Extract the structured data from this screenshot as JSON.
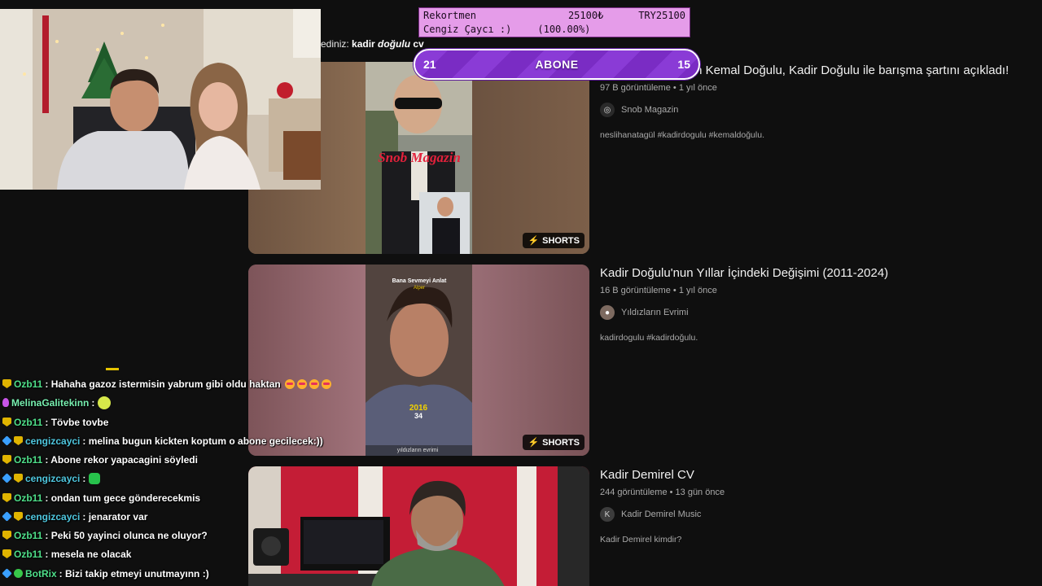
{
  "search_hint": {
    "prefix": "ediniz:",
    "query_plain": "kadir ",
    "query_emph": "doğulu",
    "query_suffix": " cv"
  },
  "results": [
    {
      "title": "…deşim yok' diyen Kemal Doğulu, Kadir Doğulu ile barışma şartını açıkladı!",
      "views": "97 B görüntüleme",
      "age": "1 yıl önce",
      "channel": "Snob Magazin",
      "channel_icon": "snob-avatar",
      "description": "neslihanatagül #kadirdogulu #kemaldoğulu.",
      "badge": "SHORTS",
      "thumb_caption": "Snob Magazin"
    },
    {
      "title": "Kadir Doğulu'nun Yıllar İçindeki Değişimi (2011-2024)",
      "views": "16 B görüntüleme",
      "age": "1 yıl önce",
      "channel": "Yıldızların Evrimi",
      "channel_icon": "person-avatar",
      "description": "kadirdogulu #kadirdoğulu.",
      "badge": "SHORTS",
      "thumb_top_title": "Bana Sevmeyi Anlat",
      "thumb_top_sub": "Alper",
      "thumb_year": "2016",
      "thumb_age": "34",
      "thumb_watermark": "yıldızların evrimi"
    },
    {
      "title": "Kadir Demirel CV",
      "views": "244 görüntüleme",
      "age": "13 gün önce",
      "channel": "Kadir Demirel Music",
      "channel_letter": "K",
      "description": "Kadir Demirel kimdir?"
    }
  ],
  "record_widget": {
    "label1": "Rekortmen",
    "value1": "25100₺",
    "value2": "TRY25100",
    "name": "Cengiz Çaycı :)",
    "percent": "(100.00%)"
  },
  "sub_goal": {
    "left": "21",
    "label": "ABONE",
    "right": "15"
  },
  "chat": [
    {
      "badge": "sub",
      "user": "Ozb11",
      "color": "green",
      "text": ": Hahaha gazoz istermisin yabrum gibi oldu haktan",
      "emotes": 4
    },
    {
      "badge": "mic",
      "user": "MelinaGalitekinn",
      "color": "mint",
      "text": ":",
      "emote_face": true
    },
    {
      "badge": "sub",
      "user": "Ozb11",
      "color": "green",
      "text": ": Tövbe tovbe"
    },
    {
      "badge": "blue-sub",
      "user": "cengizcayci",
      "color": "cyan",
      "text": ": melina bugun kickten koptum o abone gecilecek:))"
    },
    {
      "badge": "sub",
      "user": "Ozb11",
      "color": "green",
      "text": ": Abone rekor yapacagini söyledi"
    },
    {
      "badge": "blue-sub",
      "user": "cengizcayci",
      "color": "cyan",
      "text": ":",
      "emote_pepe": true
    },
    {
      "badge": "sub",
      "user": "Ozb11",
      "color": "green",
      "text": ": ondan tum gece gönderecekmis"
    },
    {
      "badge": "blue-sub",
      "user": "cengizcayci",
      "color": "cyan",
      "text": ": jenarator var"
    },
    {
      "badge": "sub",
      "user": "Ozb11",
      "color": "green",
      "text": ": Peki 50 yayinci olunca ne oluyor?"
    },
    {
      "badge": "sub",
      "user": "Ozb11",
      "color": "green",
      "text": ": mesela ne olacak"
    },
    {
      "badge": "bot",
      "user": "BotRix",
      "color": "green",
      "text": ": Bizi takip etmeyi unutmayınn :)"
    }
  ]
}
